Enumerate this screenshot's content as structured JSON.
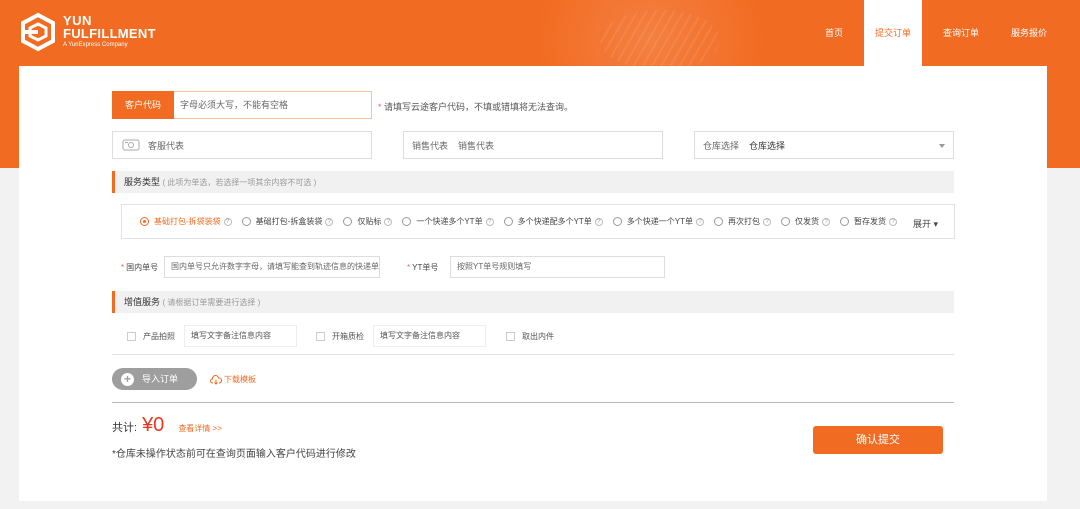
{
  "brand": {
    "line1": "YUN",
    "line2": "FULFILLMENT",
    "line3": "A YunExpress Company",
    "color": "#f26b22"
  },
  "nav": [
    {
      "label": "首页",
      "active": false
    },
    {
      "label": "提交订单",
      "active": true
    },
    {
      "label": "查询订单",
      "active": false
    },
    {
      "label": "服务报价",
      "active": false
    }
  ],
  "customer": {
    "label": "客户代码",
    "placeholder": "字母必须大写，不能有空格",
    "hint_star": "*",
    "hint": "请填写云途客户代码，不填或错填将无法查询。"
  },
  "reps": {
    "cs_placeholder": "客服代表",
    "sales_label": "销售代表",
    "sales_placeholder": "销售代表",
    "warehouse_label": "仓库选择",
    "warehouse_value": "仓库选择"
  },
  "service": {
    "title": "服务类型",
    "subtitle": "( 此项为单选，若选择一项其余内容不可选 )",
    "options": [
      {
        "label": "基础打包-拆袋装袋",
        "selected": true
      },
      {
        "label": "基础打包-拆盒装袋",
        "selected": false
      },
      {
        "label": "仅贴标",
        "selected": false
      },
      {
        "label": "一个快递多个YT单",
        "selected": false
      },
      {
        "label": "多个快递配多个YT单",
        "selected": false
      },
      {
        "label": "多个快递一个YT单",
        "selected": false
      },
      {
        "label": "再次打包",
        "selected": false
      },
      {
        "label": "仅发货",
        "selected": false
      },
      {
        "label": "暂存发货",
        "selected": false
      }
    ],
    "expand_label": "展开",
    "help_glyph": "?"
  },
  "tracking": {
    "domestic_label": "国内单号",
    "domestic_placeholder": "国内单号只允许数字字母，请填写能查到轨迹信息的快递单号",
    "yt_label": "YT单号",
    "yt_placeholder": "按照YT单号规则填写",
    "star": "*"
  },
  "vas": {
    "title": "增值服务",
    "subtitle": "( 请根据订单需要进行选择 )",
    "items": [
      {
        "label": "产品拍照",
        "placeholder": "填写文字备注信息内容"
      },
      {
        "label": "开箱质检",
        "placeholder": "填写文字备注信息内容"
      },
      {
        "label": "取出内件",
        "placeholder": ""
      }
    ]
  },
  "actions": {
    "import_label": "导入订单",
    "download_label": "下载模板"
  },
  "summary": {
    "total_label": "共计:",
    "price": "¥0",
    "detail_link": "查看详情 >>",
    "note": "*仓库未操作状态前可在查询页面输入客户代码进行修改",
    "submit_label": "确认提交"
  }
}
